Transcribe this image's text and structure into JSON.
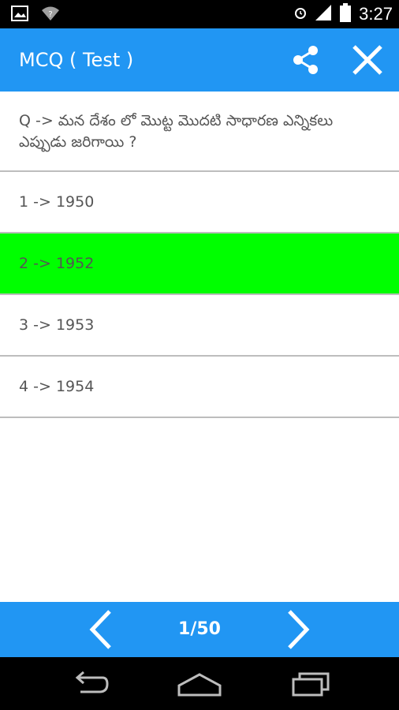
{
  "status_bar": {
    "time": "3:27",
    "icons": [
      "image-icon",
      "wifi-question-icon",
      "alarm-icon",
      "signal-icon",
      "battery-icon"
    ]
  },
  "app_bar": {
    "title": "MCQ ( Test )",
    "actions": [
      "share-icon",
      "close-icon"
    ]
  },
  "question": {
    "text": "Q -> మన దేశం లో మొట్ట మొదటి సాధారణ ఎన్నికలు ఎప్పుడు జరిగాయి ?"
  },
  "options": [
    {
      "label": "1 -> 1950",
      "state": "normal"
    },
    {
      "label": "2 -> 1952",
      "state": "correct"
    },
    {
      "label": "3 -> 1953",
      "state": "normal"
    },
    {
      "label": "4 -> 1954",
      "state": "normal"
    }
  ],
  "pagination": {
    "indicator": "1/50",
    "icons": [
      "chevron-left-icon",
      "chevron-right-icon"
    ]
  },
  "system_nav": {
    "icons": [
      "back-icon",
      "home-icon",
      "recents-icon"
    ]
  },
  "colors": {
    "primary": "#2196f3",
    "correct": "#00ff00",
    "text": "#555555",
    "divider": "#bdbdbd"
  }
}
